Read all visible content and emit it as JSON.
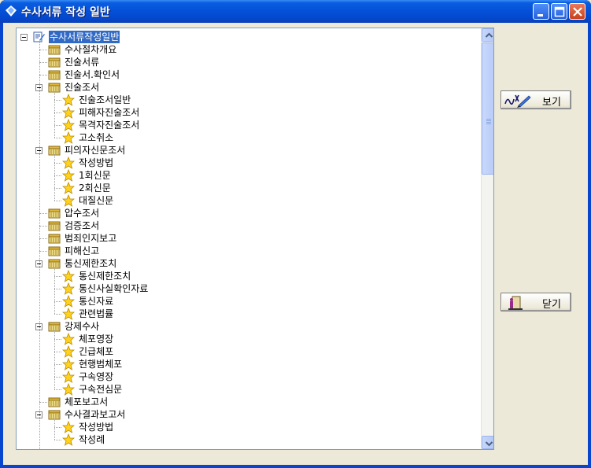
{
  "window": {
    "title": "수사서류 작성 일반",
    "controls": {
      "minimize": "minimize",
      "maximize": "maximize",
      "close": "close"
    }
  },
  "buttons": {
    "view_label": "보기",
    "close_label": "닫기"
  },
  "tree": {
    "root": "수사서류작성일반",
    "items": [
      {
        "label": "수사절차개요",
        "icon": "book-icon"
      },
      {
        "label": "진술서류",
        "icon": "book-icon"
      },
      {
        "label": "진술서.확인서",
        "icon": "book-icon"
      },
      {
        "label": "진술조서",
        "icon": "book-icon",
        "children": [
          "진술조서일반",
          "피해자진술조서",
          "목격자진술조서",
          "고소취소"
        ]
      },
      {
        "label": "피의자신문조서",
        "icon": "book-icon",
        "children": [
          "작성방법",
          "1회신문",
          "2회신문",
          "대질신문"
        ]
      },
      {
        "label": "압수조서",
        "icon": "book-icon"
      },
      {
        "label": "검증조서",
        "icon": "book-icon"
      },
      {
        "label": "범죄인지보고",
        "icon": "book-icon"
      },
      {
        "label": "피해신고",
        "icon": "book-icon"
      },
      {
        "label": "통신제한조치",
        "icon": "book-icon",
        "children": [
          "통신제한조치",
          "통신사실확인자료",
          "통신자료",
          "관련법률"
        ]
      },
      {
        "label": "강제수사",
        "icon": "book-icon",
        "children": [
          "체포영장",
          "긴급체포",
          "현행범체포",
          "구속영장",
          "구속전심문"
        ]
      },
      {
        "label": "체포보고서",
        "icon": "book-icon"
      },
      {
        "label": "수사결과보고서",
        "icon": "book-icon",
        "children": [
          "작성방법",
          "작성례"
        ]
      }
    ]
  },
  "colors": {
    "selection": "#316ac5",
    "titlebar": "#0452d8",
    "face": "#ece9d8"
  }
}
